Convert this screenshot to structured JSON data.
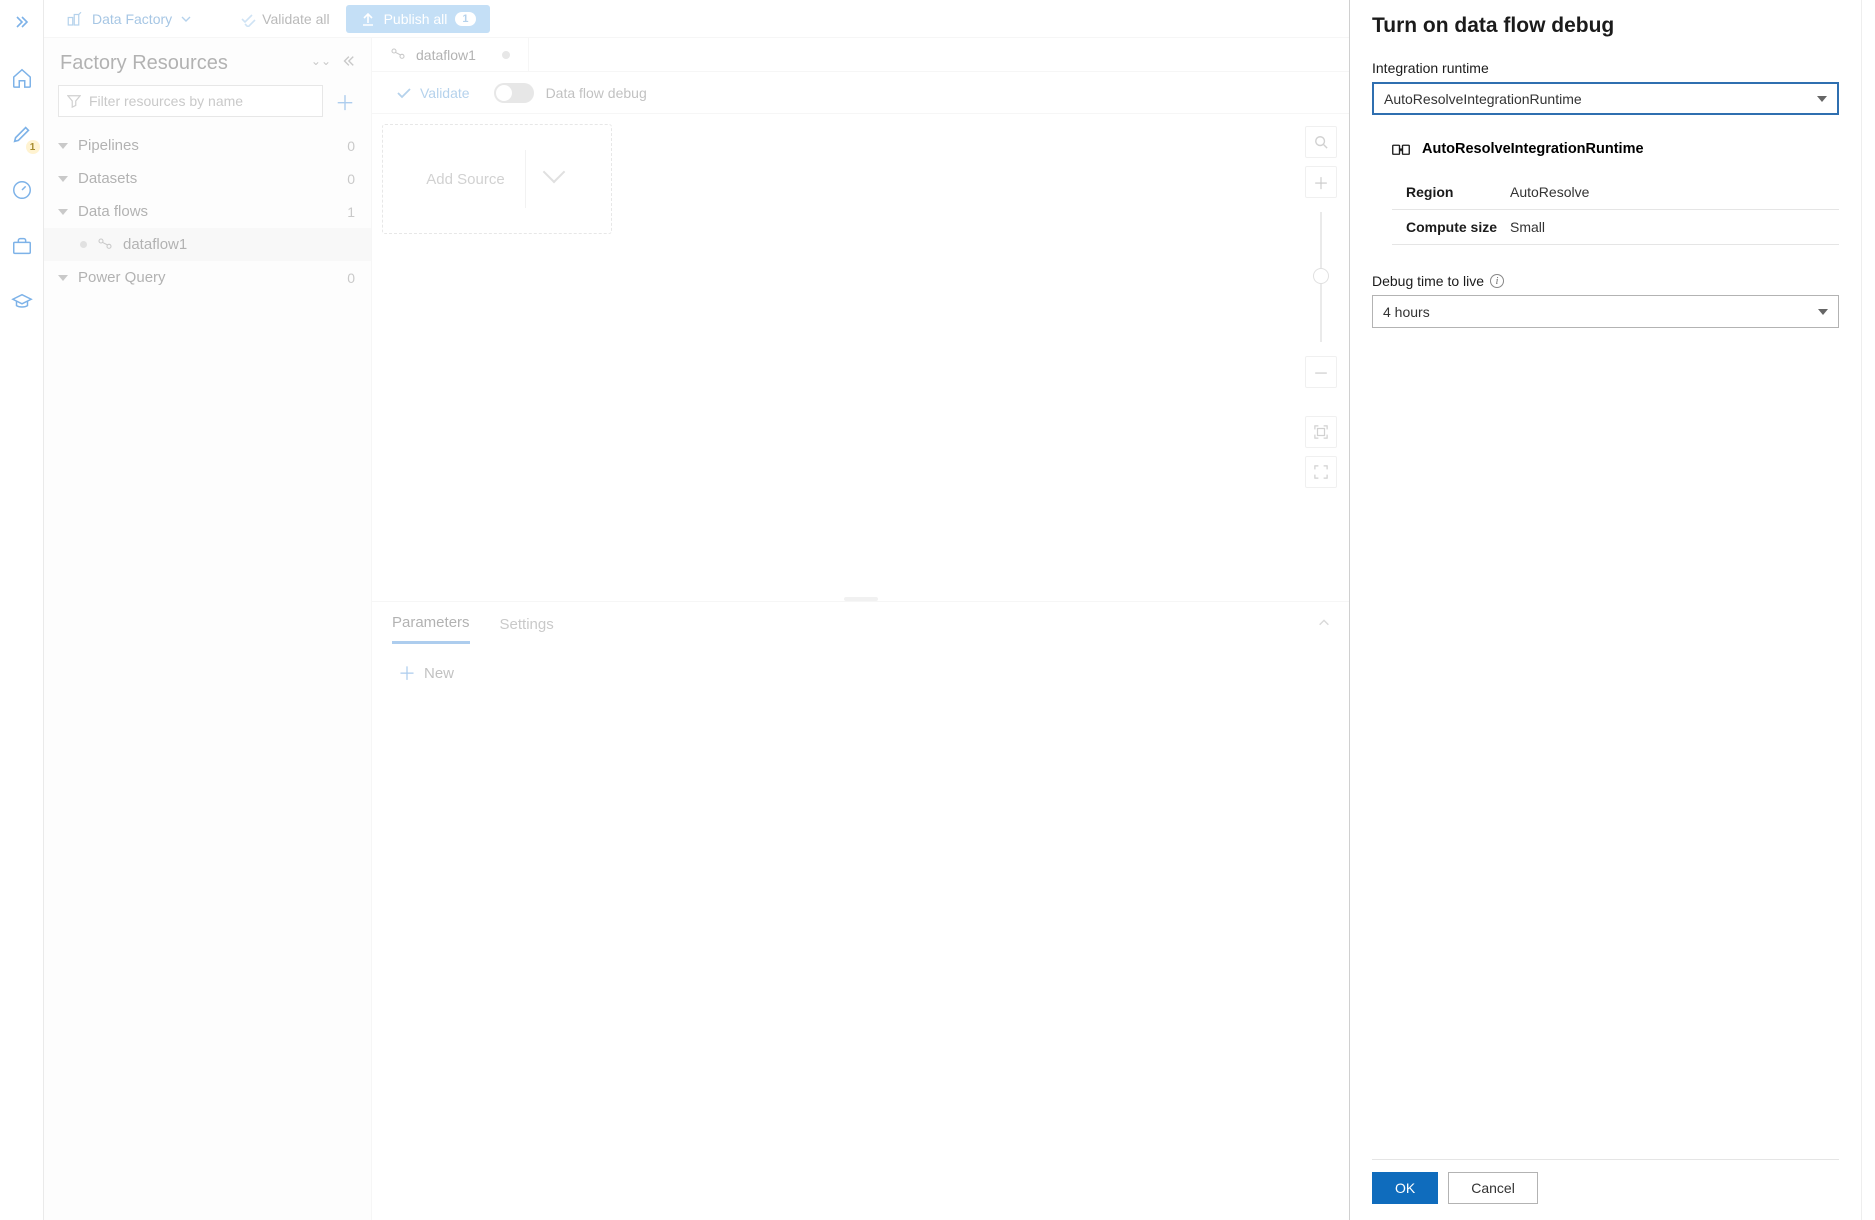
{
  "rail": {
    "pencil_badge": "1"
  },
  "topbar": {
    "crumb": "Data Factory",
    "validate_all": "Validate all",
    "publish_all": "Publish all",
    "publish_count": "1"
  },
  "resources": {
    "title": "Factory Resources",
    "filter_placeholder": "Filter resources by name",
    "groups": {
      "pipelines": {
        "label": "Pipelines",
        "count": "0"
      },
      "datasets": {
        "label": "Datasets",
        "count": "0"
      },
      "dataflows": {
        "label": "Data flows",
        "count": "1"
      },
      "powerquery": {
        "label": "Power Query",
        "count": "0"
      }
    },
    "dataflow_item": "dataflow1"
  },
  "canvas": {
    "tab_label": "dataflow1",
    "validate": "Validate",
    "debug_label": "Data flow debug",
    "add_source": "Add Source"
  },
  "bottom": {
    "tab_parameters": "Parameters",
    "tab_settings": "Settings",
    "new_button": "New"
  },
  "panel": {
    "title": "Turn on data flow debug",
    "ir_label": "Integration runtime",
    "ir_value": "AutoResolveIntegrationRuntime",
    "ir_detail_name": "AutoResolveIntegrationRuntime",
    "region_k": "Region",
    "region_v": "AutoResolve",
    "compute_k": "Compute size",
    "compute_v": "Small",
    "ttl_label": "Debug time to live",
    "ttl_value": "4 hours",
    "ok": "OK",
    "cancel": "Cancel"
  }
}
